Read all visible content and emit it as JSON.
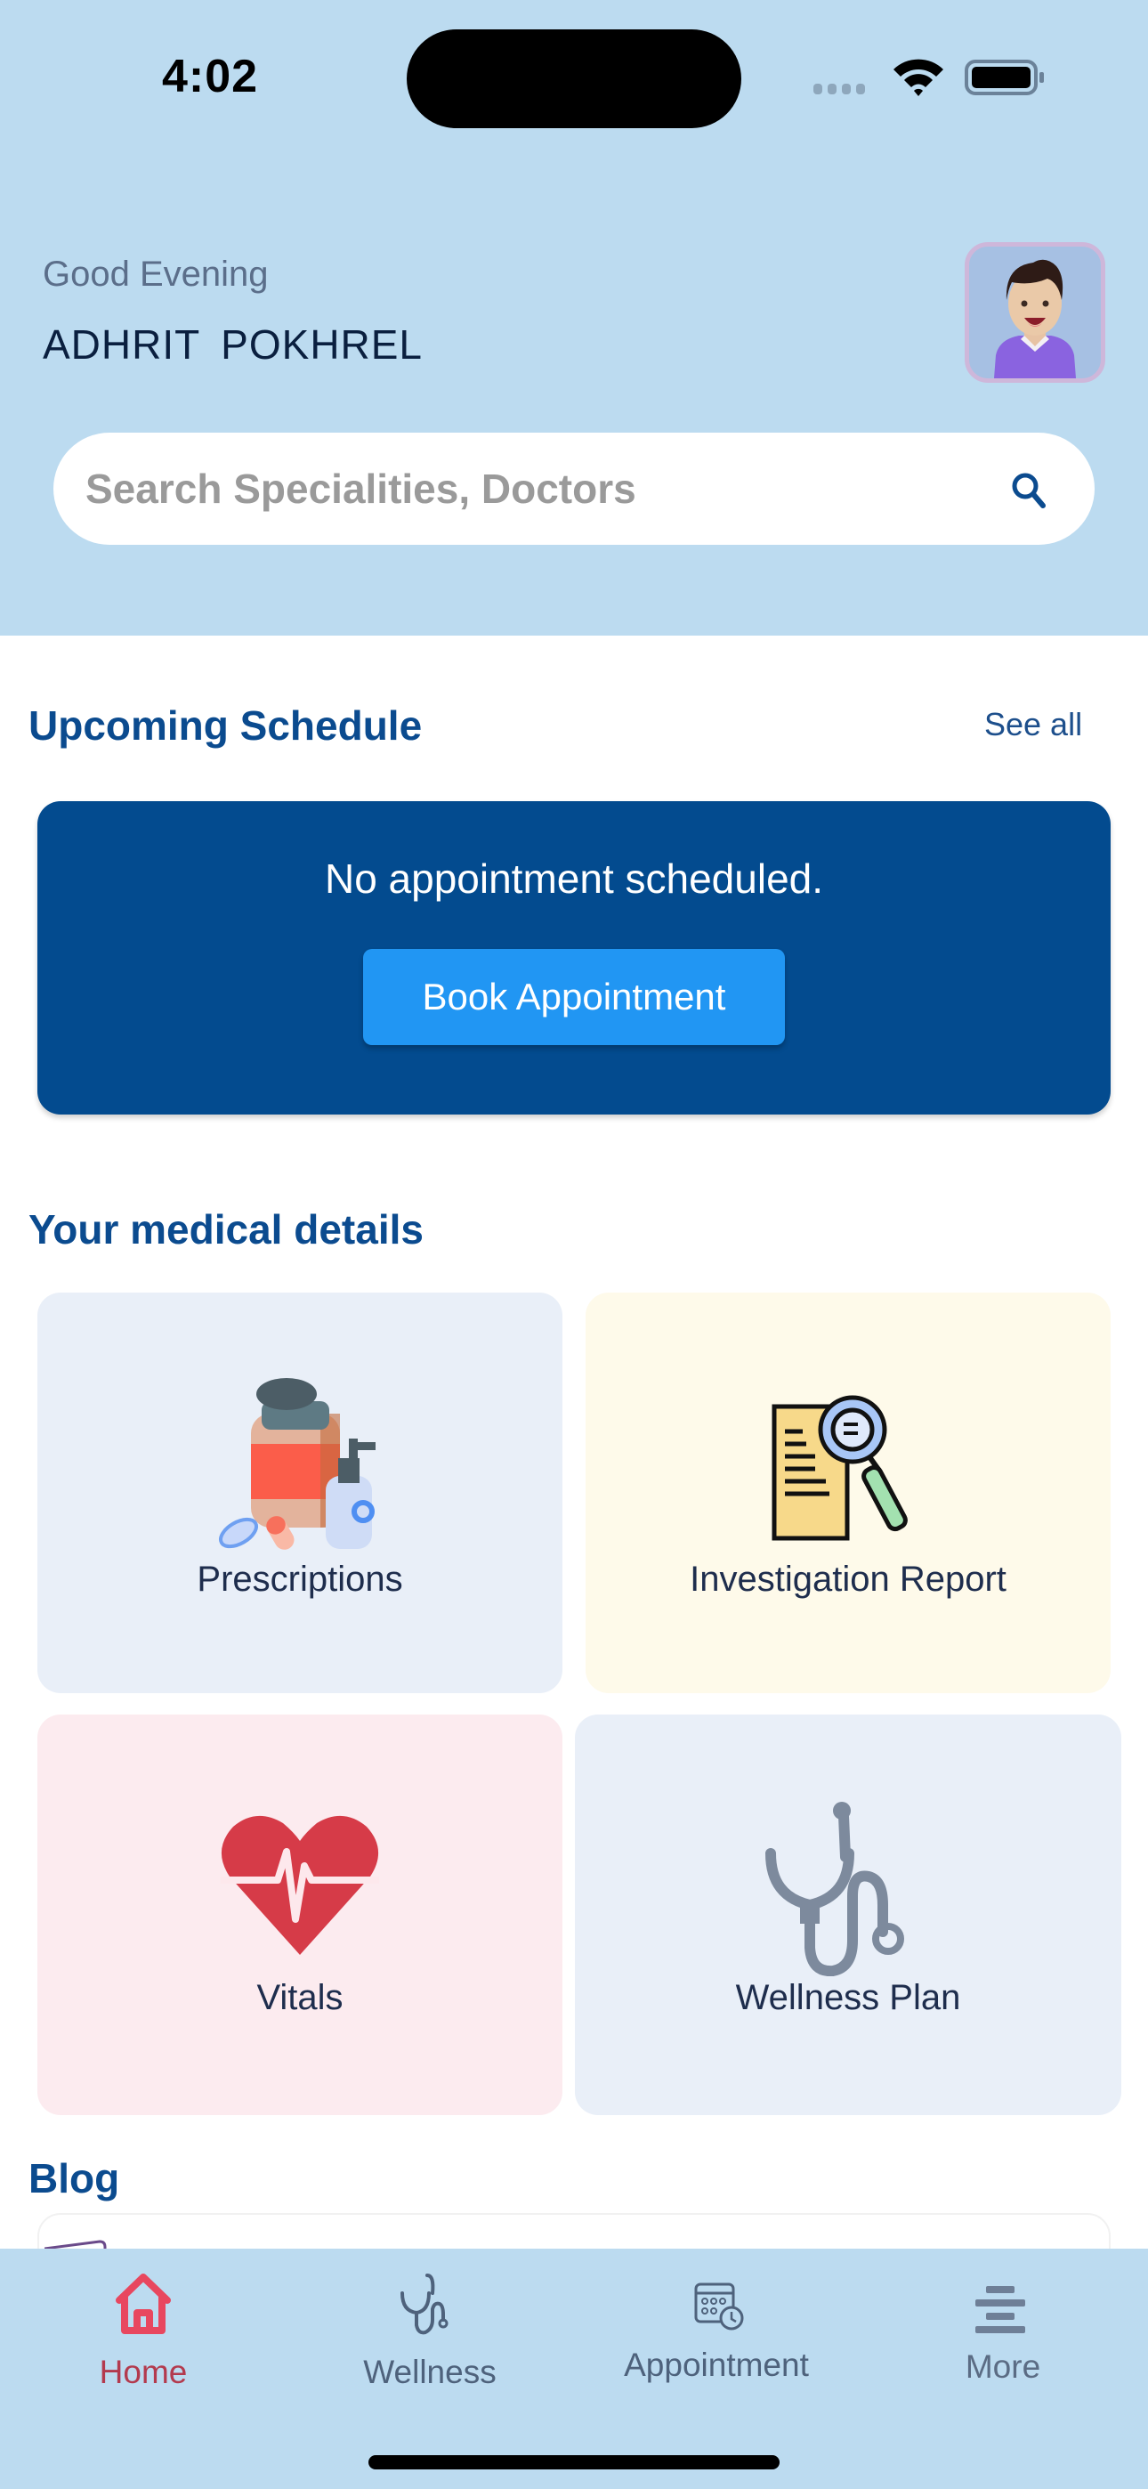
{
  "status_bar": {
    "time": "4:02",
    "icons": [
      "cellular-signal-icon",
      "wifi-icon",
      "battery-icon"
    ]
  },
  "header": {
    "greeting": "Good Evening",
    "user_name": "ADHRIT  POKHREL",
    "avatar_icon": "user-avatar-illustration"
  },
  "search": {
    "placeholder": "Search Specialities, Doctors",
    "value": "",
    "icon": "search-icon"
  },
  "upcoming_schedule": {
    "title": "Upcoming Schedule",
    "see_all_label": "See all",
    "empty_message": "No appointment scheduled.",
    "book_button_label": "Book Appointment"
  },
  "medical_details": {
    "title": "Your medical details",
    "tiles": [
      {
        "label": "Prescriptions",
        "icon": "medicine-bottle-icon",
        "bg_color": "#e9eff8"
      },
      {
        "label": "Investigation Report",
        "icon": "report-magnifier-icon",
        "bg_color": "#fefaea"
      },
      {
        "label": "Vitals",
        "icon": "heart-pulse-icon",
        "bg_color": "#fcebef"
      },
      {
        "label": "Wellness Plan",
        "icon": "stethoscope-icon",
        "bg_color": "#e9eff8"
      }
    ]
  },
  "blog": {
    "title": "Blog"
  },
  "tab_bar": {
    "active_color": "#e8475f",
    "inactive_color": "#4e627c",
    "items": [
      {
        "label": "Home",
        "icon": "home-icon",
        "active": true
      },
      {
        "label": "Wellness",
        "icon": "stethoscope-icon",
        "active": false
      },
      {
        "label": "Appointment",
        "icon": "calendar-clock-icon",
        "active": false
      },
      {
        "label": "More",
        "icon": "menu-lines-icon",
        "active": false
      }
    ]
  },
  "colors": {
    "header_bg": "#bcdbf0",
    "primary_dark": "#034b8f",
    "button_blue": "#2196f3",
    "section_title": "#0b4b8f"
  }
}
